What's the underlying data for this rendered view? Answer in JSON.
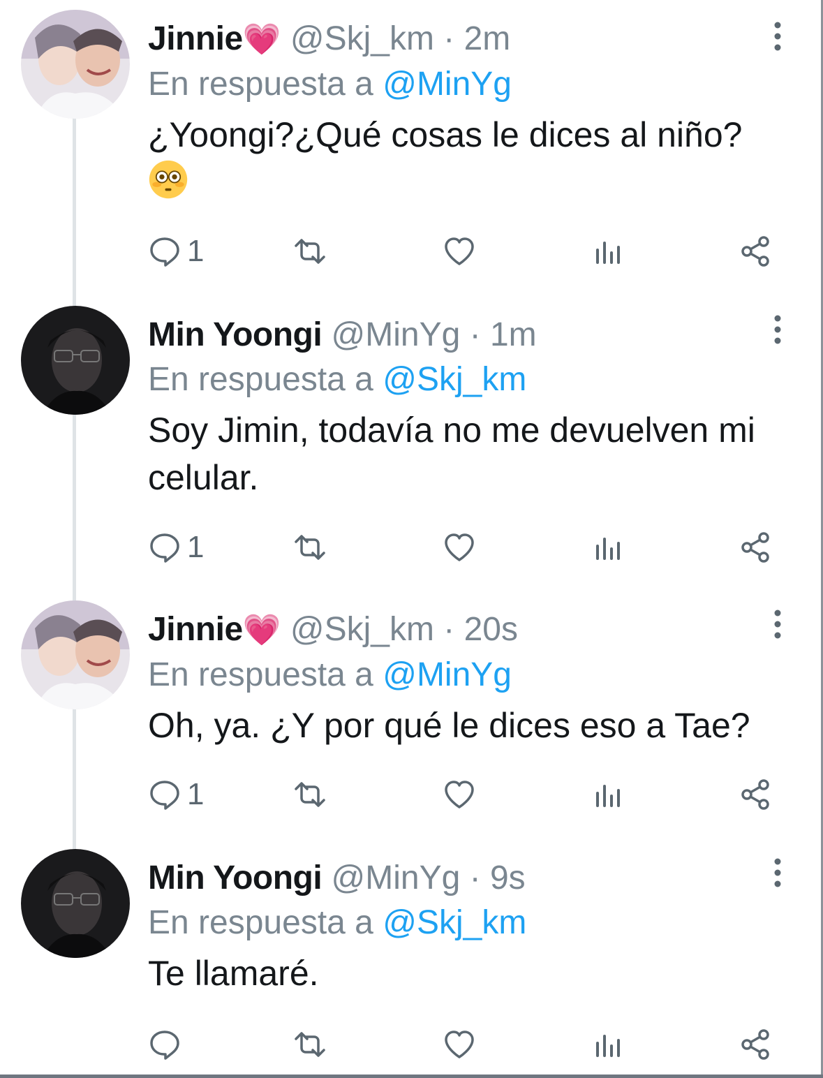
{
  "tweets": [
    {
      "name": "Jinnie",
      "name_emoji": "💗",
      "handle": "@Skj_km",
      "time": "· 2m",
      "reply_prefix": "En respuesta a",
      "reply_to": "@MinYg",
      "text": "¿Yoongi?¿Qué cosas le dices al niño?",
      "emoji": "flushed-face",
      "reply_count": "1",
      "avatar": "avatar-jinnie"
    },
    {
      "name": "Min Yoongi",
      "name_emoji": "",
      "handle": "@MinYg",
      "time": "· 1m",
      "reply_prefix": "En respuesta a",
      "reply_to": "@Skj_km",
      "text": "Soy Jimin, todavía no me devuelven mi celular.",
      "reply_count": "1",
      "avatar": "avatar-yoongi"
    },
    {
      "name": "Jinnie",
      "name_emoji": "💗",
      "handle": "@Skj_km",
      "time": "· 20s",
      "reply_prefix": "En respuesta a",
      "reply_to": "@MinYg",
      "text": "Oh, ya. ¿Y por qué le dices eso a Tae?",
      "reply_count": "1",
      "avatar": "avatar-jinnie"
    },
    {
      "name": "Min Yoongi",
      "name_emoji": "",
      "handle": "@MinYg",
      "time": "· 9s",
      "reply_prefix": "En respuesta a",
      "reply_to": "@Skj_km",
      "text": "Te llamaré.",
      "reply_count": "",
      "avatar": "avatar-yoongi"
    }
  ],
  "colors": {
    "mention": "#1da1f2",
    "meta": "#7a8690",
    "heart": "#f0629c"
  },
  "icons": [
    "reply-icon",
    "retweet-icon",
    "like-icon",
    "analytics-icon",
    "share-icon",
    "more-options-icon"
  ]
}
